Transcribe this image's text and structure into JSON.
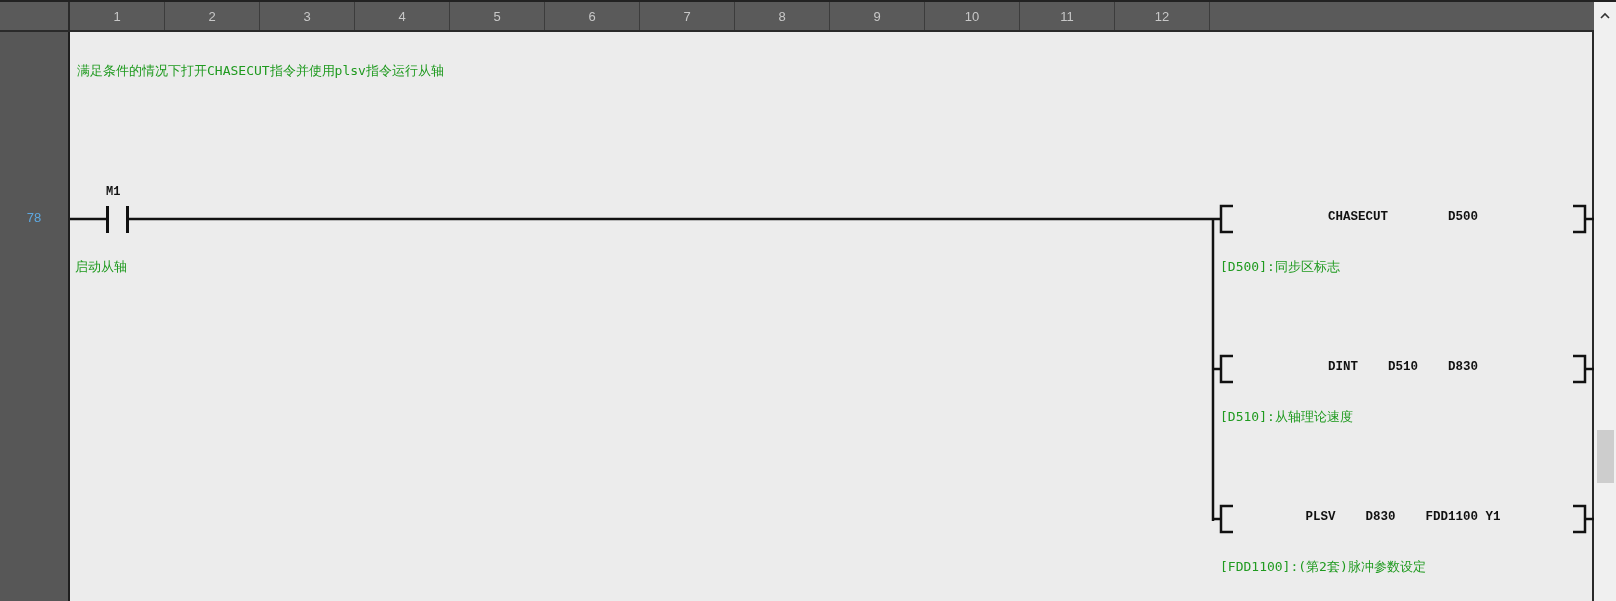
{
  "column_headers": [
    "1",
    "2",
    "3",
    "4",
    "5",
    "6",
    "7",
    "8",
    "9",
    "10",
    "11",
    "12"
  ],
  "comment": "满足条件的情况下打开CHASECUT指令并使用plsv指令运行从轴",
  "rung": {
    "number": "78",
    "contact": {
      "kind": "normally_open",
      "operand": "M1",
      "comment": "启动从轴"
    },
    "instructions": [
      {
        "operands": [
          "CHASECUT",
          "D500"
        ],
        "comment": "[D500]:同步区标志"
      },
      {
        "operands": [
          "DINT",
          "D510",
          "D830"
        ],
        "comment": "[D510]:从轴理论速度"
      },
      {
        "operands": [
          "PLSV",
          "D830",
          "FDD1100",
          "Y1"
        ],
        "comment": "[FDD1100]:(第2套)脉冲参数设定"
      }
    ]
  }
}
